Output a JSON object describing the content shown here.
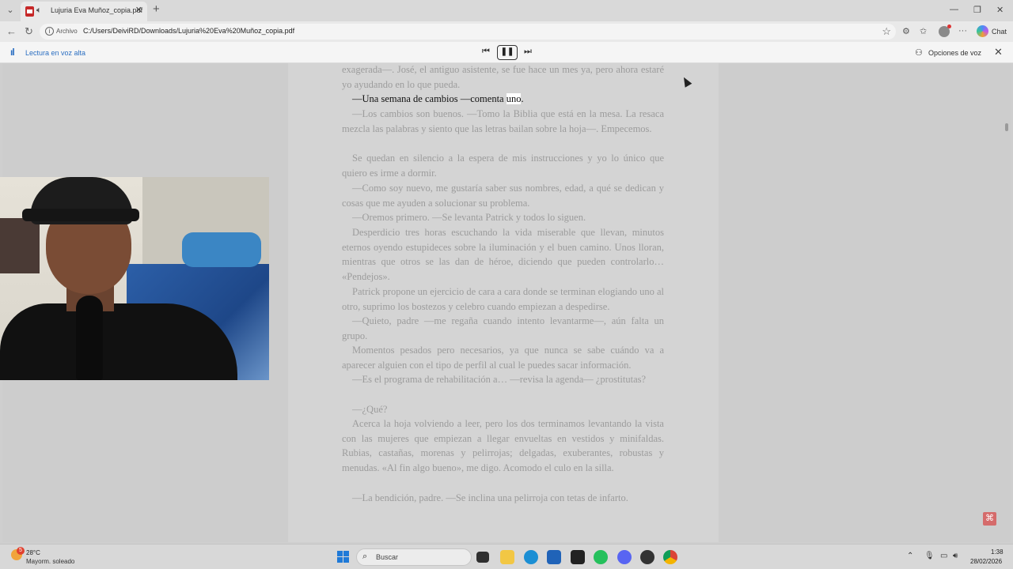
{
  "browser": {
    "tab_title": "Lujuria Eva Muñoz_copia.pdf",
    "new_tab_icon": "plus-icon",
    "url_scheme_label": "Archivo",
    "url": "C:/Users/DeiviRD/Downloads/Lujuria%20Eva%20Muñoz_copia.pdf",
    "chat_label": "Chat"
  },
  "read_aloud": {
    "label": "Lectura en voz alta",
    "voice_options_label": "Opciones de voz",
    "state": "playing"
  },
  "pdf": {
    "paragraphs": [
      {
        "text": "exagerada—. José, el antiguo asistente, se fue hace un mes ya, pero ahora estaré yo ayudando en lo que pueda.",
        "indent": false,
        "active": false
      },
      {
        "text_before": "—Una semana de cambios —comenta ",
        "highlight": "uno",
        "text_after": ".",
        "indent": true,
        "active": true
      },
      {
        "text": "—Los cambios son buenos. —Tomo la Biblia que está en la mesa. La resaca mezcla las palabras y siento que las letras bailan sobre la hoja—. Empecemos.",
        "indent": true,
        "active": false
      },
      {
        "text": "Se quedan en silencio a la espera de mis instrucciones y yo lo único que quiero es irme a dormir.",
        "indent": true,
        "active": false
      },
      {
        "text": "—Como soy nuevo, me gustaría saber sus nombres, edad, a qué se dedican y cosas que me ayuden a solucionar su problema.",
        "indent": true,
        "active": false
      },
      {
        "text": "—Oremos primero. —Se levanta Patrick y todos lo siguen.",
        "indent": true,
        "active": false
      },
      {
        "text": "Desperdicio tres horas escuchando la vida miserable que llevan, minutos eternos oyendo estupideces sobre la iluminación y el buen camino. Unos lloran, mientras que otros se las dan de héroe, diciendo que pueden controlarlo… «Pendejos».",
        "indent": true,
        "active": false
      },
      {
        "text": "Patrick propone un ejercicio de cara a cara donde se terminan elogiando uno al otro, suprimo los bostezos y celebro cuando empiezan a despedirse.",
        "indent": true,
        "active": false
      },
      {
        "text": "—Quieto, padre —me regaña cuando intento levantarme—, aún falta un grupo.",
        "indent": true,
        "active": false
      },
      {
        "text": "Momentos pesados pero necesarios, ya que nunca se sabe cuándo va a aparecer alguien con el tipo de perfil al cual le puedes sacar información.",
        "indent": true,
        "active": false
      },
      {
        "text": "—Es el programa de rehabilitación a… —revisa la agenda— ¿prostitutas?",
        "indent": true,
        "active": false
      },
      {
        "text": "—¿Qué?",
        "indent": true,
        "active": false
      },
      {
        "text": "Acerca la hoja volviendo a leer, pero los dos terminamos levantando la vista con las mujeres que empiezan a llegar envueltas en vestidos y minifaldas. Rubias, castañas, morenas y pelirrojas; delgadas, exuberantes, robustas y menudas. «Al fin algo bueno», me digo. Acomodo el culo en la silla.",
        "indent": true,
        "active": false
      },
      {
        "text": "—La bendición, padre. —Se inclina una pelirroja con tetas de infarto.",
        "indent": true,
        "active": false
      }
    ]
  },
  "taskbar": {
    "temperature": "28°C",
    "weather_desc": "Mayorm. soleado",
    "weather_badge": "5",
    "search_label": "Buscar",
    "time": "1:38",
    "date": "28/02/2026"
  },
  "colors": {
    "accent": "#2b6fc2",
    "pdf_red": "#c62828"
  }
}
